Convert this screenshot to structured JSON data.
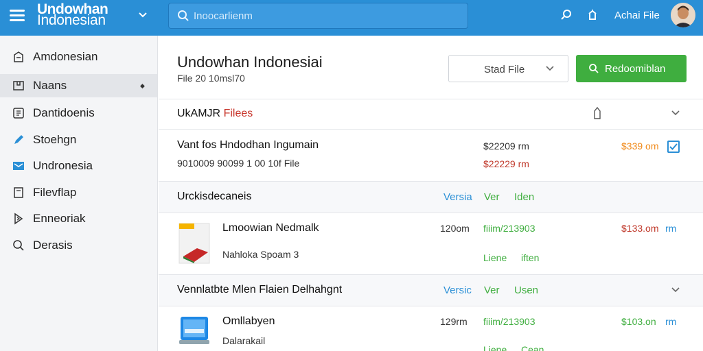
{
  "header": {
    "brand_line1": "Undowhan",
    "brand_line2": "Indonesian",
    "search_placeholder": "Inoocarlienm",
    "user_name": "Achai  File"
  },
  "sidebar": {
    "items": [
      {
        "label": "Amdonesian",
        "icon": "brand-icon"
      },
      {
        "label": "Naans",
        "icon": "tag-icon",
        "active": true
      },
      {
        "label": "Dantidoenis",
        "icon": "box-icon"
      },
      {
        "label": "Stoehgn",
        "icon": "pen-icon"
      },
      {
        "label": "Undronesia",
        "icon": "mail-icon"
      },
      {
        "label": "Filevflap",
        "icon": "file-icon"
      },
      {
        "label": "Enneoriak",
        "icon": "edit-icon"
      },
      {
        "label": "Derasis",
        "icon": "search-icon"
      }
    ]
  },
  "main": {
    "title": "Undowhan Indonesiai",
    "subtitle": "File 20 10msl70",
    "select_label": "Stad File",
    "action_label": "Redoomiblan",
    "section1": {
      "title_prefix": "UkAMJR ",
      "title_red": "Filees",
      "row": {
        "name": "Vant fos Hndodhan Ingumain",
        "meta": "9010009 90099 1 00 10f File",
        "price1": "$22209 rm",
        "price2": "$22229 rm",
        "price3": "$339 om"
      }
    },
    "section2": {
      "title": "Urckisdecaneis",
      "col1": "Versia",
      "col2": "Ver",
      "col3": "Iden",
      "row": {
        "name": "Lmoowian Nedmalk",
        "sub": "Nahloka Spoam 3",
        "size": "120om",
        "ver": "fiiim/213903",
        "tag1": "Liene",
        "tag2": "iften",
        "price": "$133.om",
        "unit": "rm"
      }
    },
    "section3": {
      "title": "Vennlatbte Mlen Flaien Delhahgnt",
      "col1": "Versic",
      "col2": "Ver",
      "col3": "Usen",
      "row": {
        "name": "Omllabyen",
        "sub": "Dalarakail",
        "size": "129rm",
        "ver": "fiiim/213903",
        "tag1": "Liene",
        "tag2": "Cean",
        "price": "$103.on",
        "unit": "rm"
      }
    }
  },
  "colors": {
    "topbar": "#2a8fd6",
    "accent_green": "#3fae3f",
    "orange": "#f08a1a",
    "red": "#c7342a"
  }
}
